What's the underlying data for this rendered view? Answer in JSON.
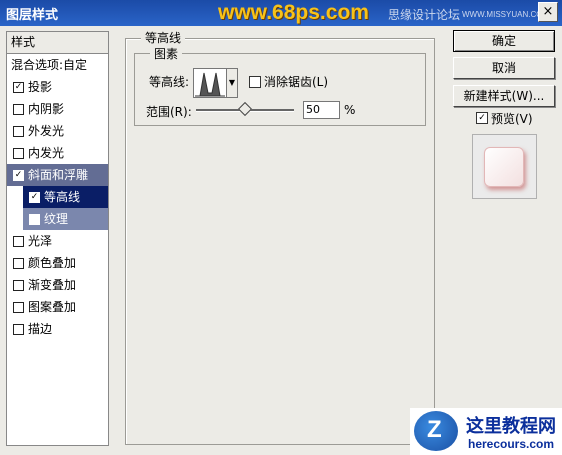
{
  "window": {
    "title": "图层样式",
    "close_glyph": "×"
  },
  "watermark": {
    "site": "www.68ps.com",
    "text1": "思缘设计论坛",
    "text2": "WWW.MISSYUAN.COM"
  },
  "left_panel": {
    "header": "样式",
    "blend_options": "混合选项:自定",
    "items": [
      {
        "label": "投影",
        "checked": true
      },
      {
        "label": "内阴影",
        "checked": false
      },
      {
        "label": "外发光",
        "checked": false
      },
      {
        "label": "内发光",
        "checked": false
      },
      {
        "label": "斜面和浮雕",
        "checked": true
      },
      {
        "label": "等高线",
        "checked": true
      },
      {
        "label": "纹理",
        "checked": false
      },
      {
        "label": "光泽",
        "checked": false
      },
      {
        "label": "颜色叠加",
        "checked": false
      },
      {
        "label": "渐变叠加",
        "checked": false
      },
      {
        "label": "图案叠加",
        "checked": false
      },
      {
        "label": "描边",
        "checked": false
      }
    ]
  },
  "contour_section": {
    "title": "等高线",
    "group_title": "图素",
    "contour_label": "等高线:",
    "antialias_label": "消除锯齿(L)",
    "antialias_checked": false,
    "range_label": "范围(R):",
    "range_value": "50",
    "range_unit": "%",
    "range_slider_fraction": 0.5
  },
  "buttons": {
    "ok": "确定",
    "cancel": "取消",
    "new_style": "新建样式(W)...",
    "preview_label": "预览(V)",
    "preview_checked": true
  },
  "logo": {
    "title": "这里教程网",
    "subtitle": "herecours.com",
    "mark": "Z"
  },
  "check_glyph": "✓"
}
